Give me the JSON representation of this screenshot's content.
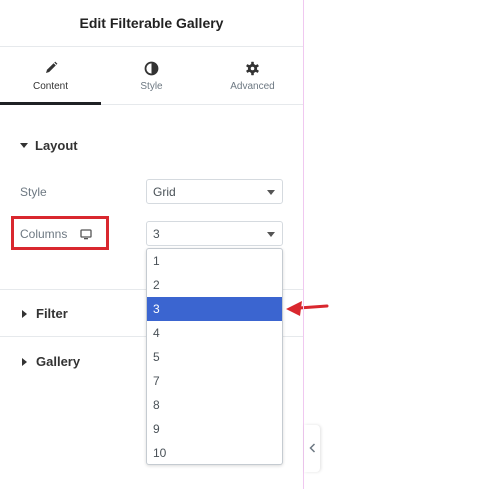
{
  "header": {
    "title": "Edit Filterable Gallery"
  },
  "tabs": [
    {
      "label": "Content",
      "icon": "pencil-icon"
    },
    {
      "label": "Style",
      "icon": "half-circle-icon"
    },
    {
      "label": "Advanced",
      "icon": "gear-icon"
    }
  ],
  "layout": {
    "title": "Layout",
    "style": {
      "label": "Style",
      "value": "Grid"
    },
    "columns": {
      "label": "Columns",
      "value": "3",
      "device_icon": "desktop-icon"
    }
  },
  "dropdown": {
    "options": [
      "1",
      "2",
      "3",
      "4",
      "5",
      "7",
      "8",
      "9",
      "10"
    ],
    "selected": "3"
  },
  "sections": {
    "filter": "Filter",
    "gallery": "Gallery"
  },
  "colors": {
    "accent": "#3b65d0",
    "highlight": "#d9272e",
    "guide": "#f0c8f0"
  }
}
